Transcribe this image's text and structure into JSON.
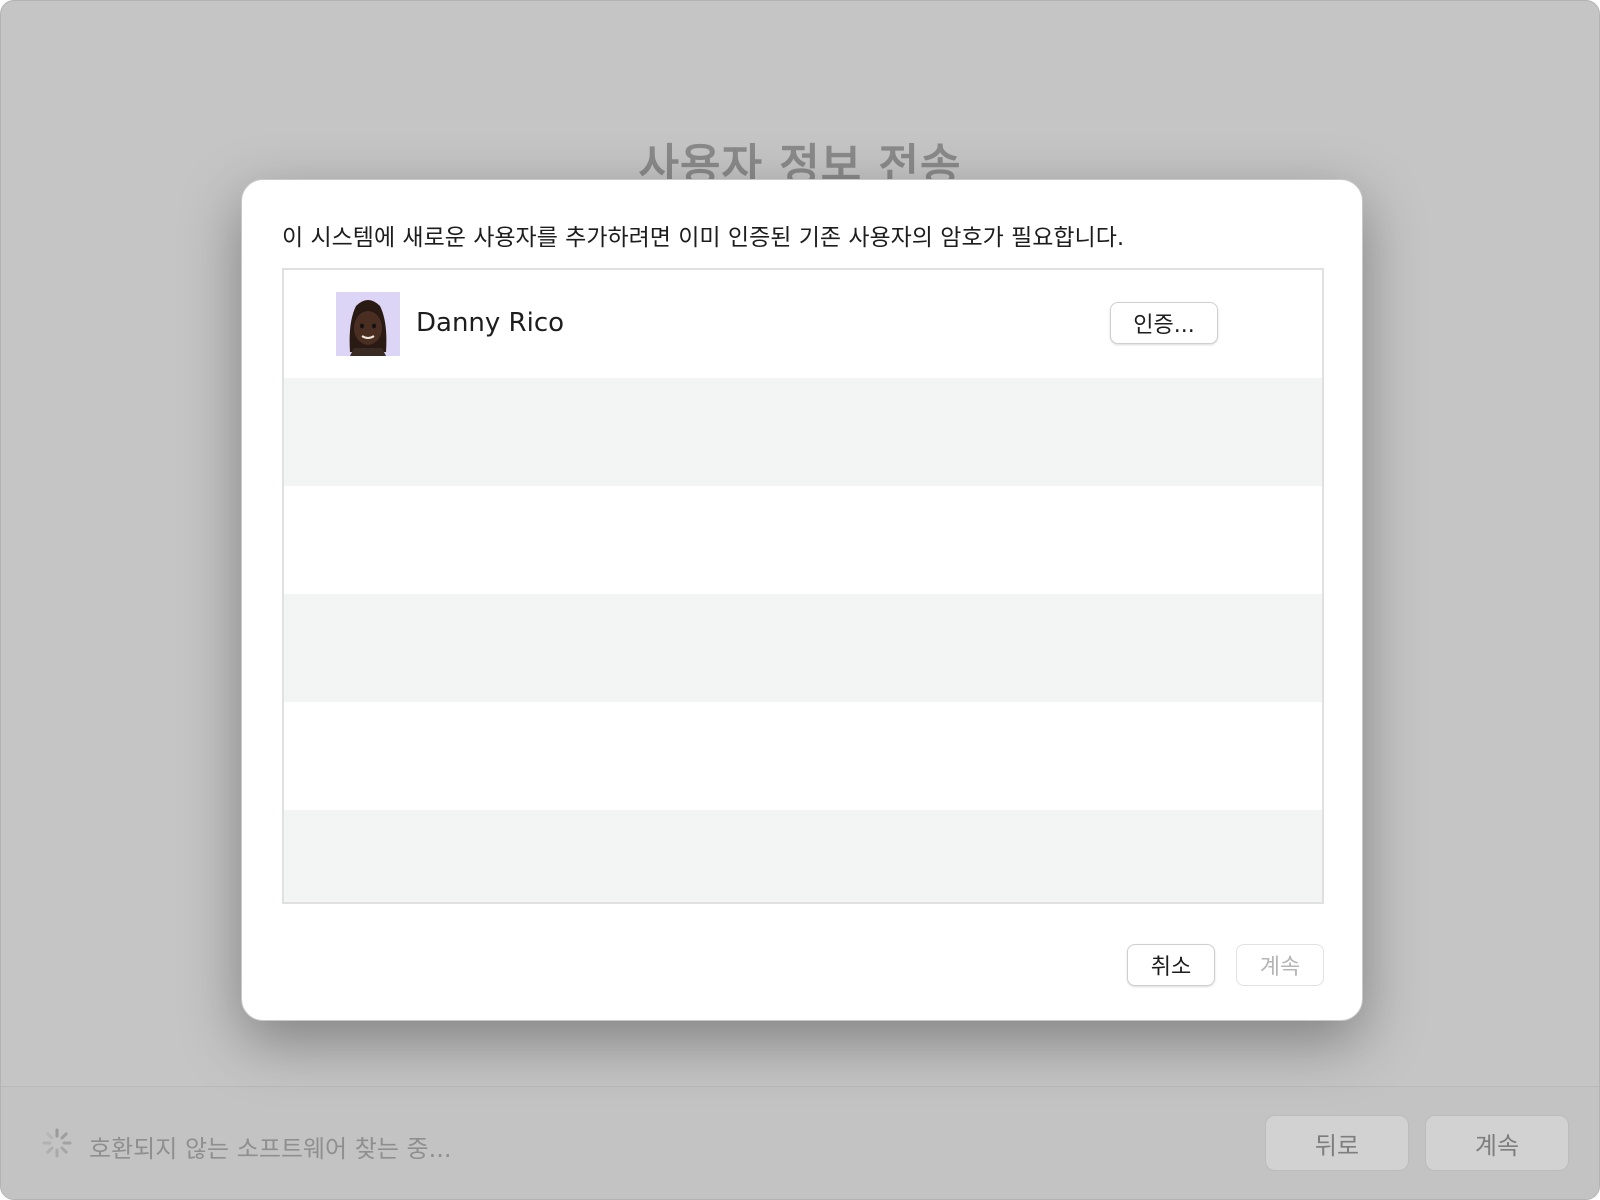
{
  "window": {
    "page_title": "사용자 정보 전송"
  },
  "footer": {
    "status_text": "호환되지 않는 소프트웨어 찾는 중...",
    "back_label": "뒤로",
    "continue_label": "계속"
  },
  "dialog": {
    "message": "이 시스템에 새로운 사용자를 추가하려면 이미 인증된 기존 사용자의 암호가 필요합니다.",
    "users": [
      {
        "name": "Danny Rico",
        "auth_label": "인증..."
      }
    ],
    "cancel_label": "취소",
    "continue_label": "계속",
    "continue_enabled": false
  },
  "colors": {
    "row_alt": "#f3f4f4",
    "avatar_bg": "#ddd5f6",
    "dimmed_text": "#b5b5b5"
  }
}
